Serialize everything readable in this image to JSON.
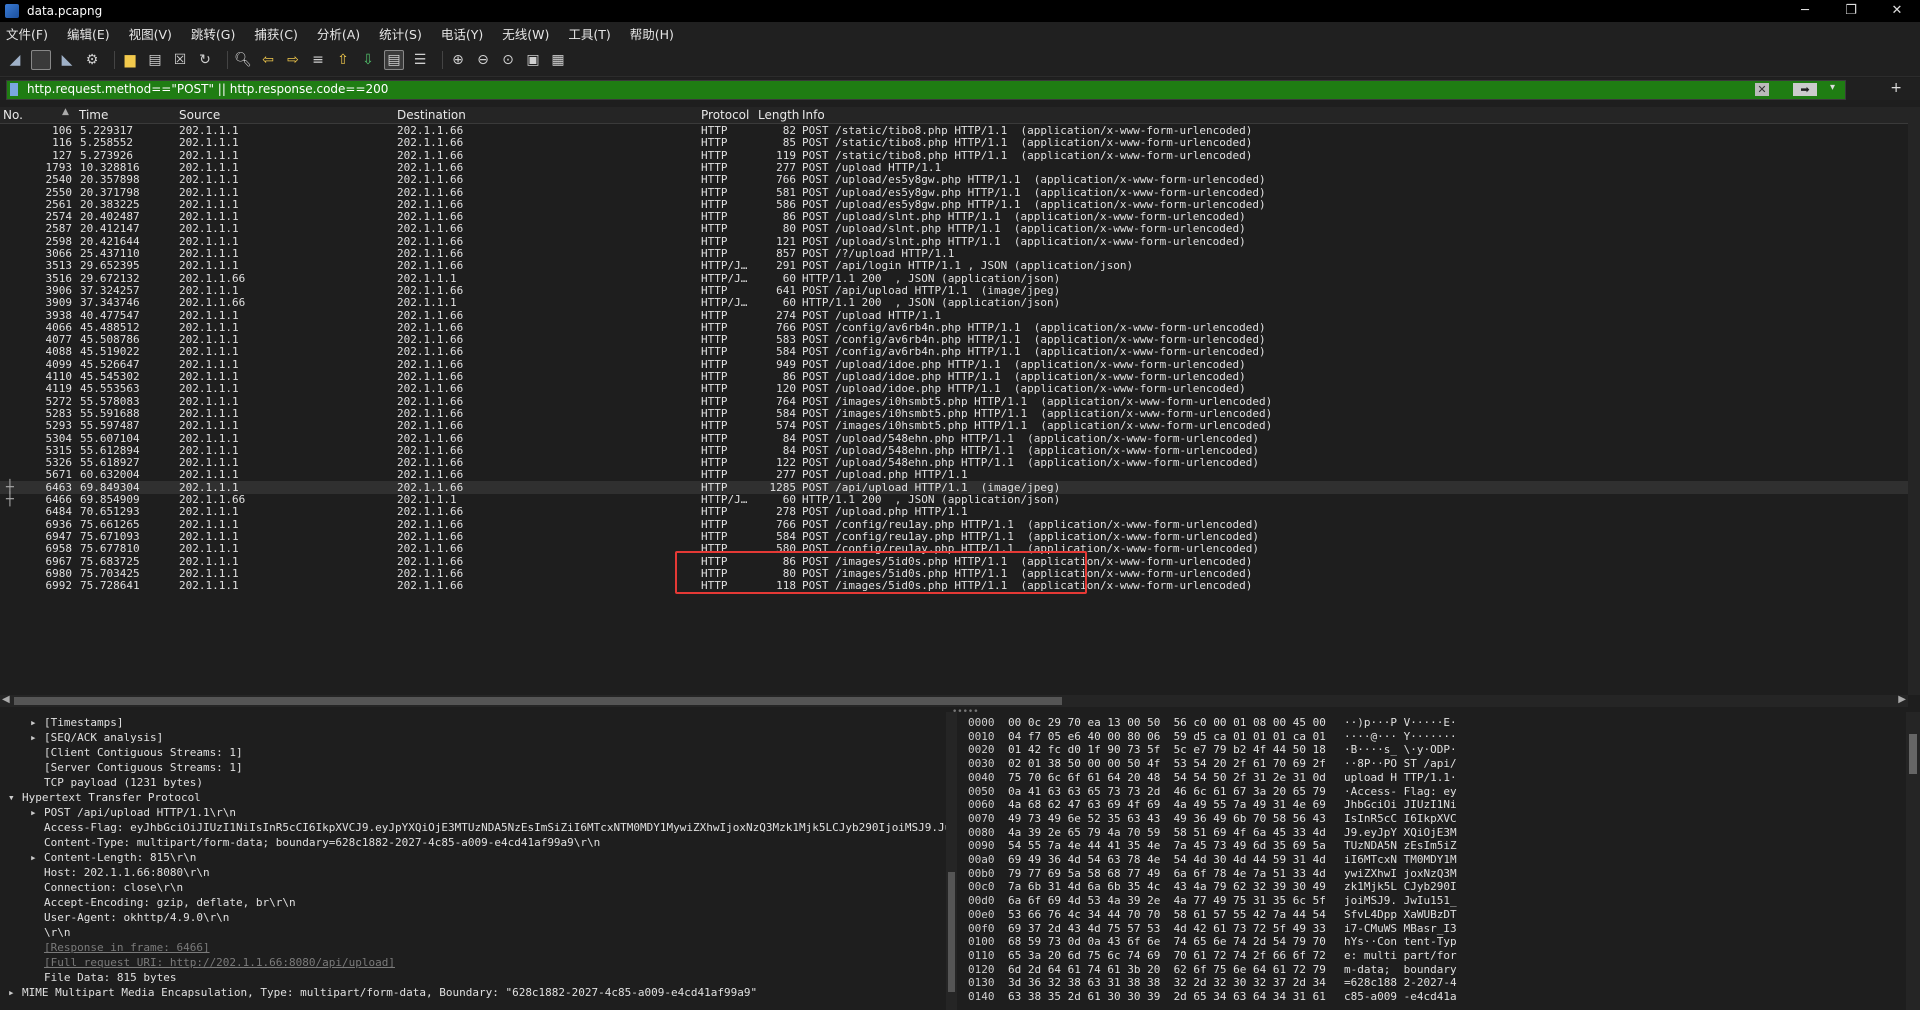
{
  "window": {
    "title": "data.pcapng",
    "controls": [
      "─",
      "❐",
      "✕"
    ]
  },
  "menu": [
    "文件(F)",
    "编辑(E)",
    "视图(V)",
    "跳转(G)",
    "捕获(C)",
    "分析(A)",
    "统计(S)",
    "电话(Y)",
    "无线(W)",
    "工具(T)",
    "帮助(H)"
  ],
  "filter": {
    "text": "http.request.method==\"POST\" || http.response.code==200"
  },
  "columns": {
    "no": "No.",
    "time": "Time",
    "source": "Source",
    "destination": "Destination",
    "protocol": "Protocol",
    "length": "Length",
    "info": "Info"
  },
  "packets": [
    [
      "106",
      "5.229317",
      "202.1.1.1",
      "202.1.1.66",
      "HTTP",
      "82",
      "POST /static/tibo8.php HTTP/1.1  (application/x-www-form-urlencoded)"
    ],
    [
      "116",
      "5.258552",
      "202.1.1.1",
      "202.1.1.66",
      "HTTP",
      "85",
      "POST /static/tibo8.php HTTP/1.1  (application/x-www-form-urlencoded)"
    ],
    [
      "127",
      "5.273926",
      "202.1.1.1",
      "202.1.1.66",
      "HTTP",
      "119",
      "POST /static/tibo8.php HTTP/1.1  (application/x-www-form-urlencoded)"
    ],
    [
      "1793",
      "10.328816",
      "202.1.1.1",
      "202.1.1.66",
      "HTTP",
      "277",
      "POST /upload HTTP/1.1"
    ],
    [
      "2540",
      "20.357898",
      "202.1.1.1",
      "202.1.1.66",
      "HTTP",
      "766",
      "POST /upload/es5y8gw.php HTTP/1.1  (application/x-www-form-urlencoded)"
    ],
    [
      "2550",
      "20.371798",
      "202.1.1.1",
      "202.1.1.66",
      "HTTP",
      "581",
      "POST /upload/es5y8gw.php HTTP/1.1  (application/x-www-form-urlencoded)"
    ],
    [
      "2561",
      "20.383225",
      "202.1.1.1",
      "202.1.1.66",
      "HTTP",
      "586",
      "POST /upload/es5y8gw.php HTTP/1.1  (application/x-www-form-urlencoded)"
    ],
    [
      "2574",
      "20.402487",
      "202.1.1.1",
      "202.1.1.66",
      "HTTP",
      "86",
      "POST /upload/slnt.php HTTP/1.1  (application/x-www-form-urlencoded)"
    ],
    [
      "2587",
      "20.412147",
      "202.1.1.1",
      "202.1.1.66",
      "HTTP",
      "80",
      "POST /upload/slnt.php HTTP/1.1  (application/x-www-form-urlencoded)"
    ],
    [
      "2598",
      "20.421644",
      "202.1.1.1",
      "202.1.1.66",
      "HTTP",
      "121",
      "POST /upload/slnt.php HTTP/1.1  (application/x-www-form-urlencoded)"
    ],
    [
      "3066",
      "25.437110",
      "202.1.1.1",
      "202.1.1.66",
      "HTTP",
      "857",
      "POST /?/upload HTTP/1.1"
    ],
    [
      "3513",
      "29.652395",
      "202.1.1.1",
      "202.1.1.66",
      "HTTP/J…",
      "291",
      "POST /api/login HTTP/1.1 , JSON (application/json)"
    ],
    [
      "3516",
      "29.672132",
      "202.1.1.66",
      "202.1.1.1",
      "HTTP/J…",
      "60",
      "HTTP/1.1 200  , JSON (application/json)"
    ],
    [
      "3906",
      "37.324257",
      "202.1.1.1",
      "202.1.1.66",
      "HTTP",
      "641",
      "POST /api/upload HTTP/1.1  (image/jpeg)"
    ],
    [
      "3909",
      "37.343746",
      "202.1.1.66",
      "202.1.1.1",
      "HTTP/J…",
      "60",
      "HTTP/1.1 200  , JSON (application/json)"
    ],
    [
      "3938",
      "40.477547",
      "202.1.1.1",
      "202.1.1.66",
      "HTTP",
      "274",
      "POST /upload HTTP/1.1"
    ],
    [
      "4066",
      "45.488512",
      "202.1.1.1",
      "202.1.1.66",
      "HTTP",
      "766",
      "POST /config/av6rb4n.php HTTP/1.1  (application/x-www-form-urlencoded)"
    ],
    [
      "4077",
      "45.508786",
      "202.1.1.1",
      "202.1.1.66",
      "HTTP",
      "583",
      "POST /config/av6rb4n.php HTTP/1.1  (application/x-www-form-urlencoded)"
    ],
    [
      "4088",
      "45.519022",
      "202.1.1.1",
      "202.1.1.66",
      "HTTP",
      "584",
      "POST /config/av6rb4n.php HTTP/1.1  (application/x-www-form-urlencoded)"
    ],
    [
      "4099",
      "45.526647",
      "202.1.1.1",
      "202.1.1.66",
      "HTTP",
      "949",
      "POST /upload/idoe.php HTTP/1.1  (application/x-www-form-urlencoded)"
    ],
    [
      "4110",
      "45.545302",
      "202.1.1.1",
      "202.1.1.66",
      "HTTP",
      "86",
      "POST /upload/idoe.php HTTP/1.1  (application/x-www-form-urlencoded)"
    ],
    [
      "4119",
      "45.553563",
      "202.1.1.1",
      "202.1.1.66",
      "HTTP",
      "120",
      "POST /upload/idoe.php HTTP/1.1  (application/x-www-form-urlencoded)"
    ],
    [
      "5272",
      "55.578083",
      "202.1.1.1",
      "202.1.1.66",
      "HTTP",
      "764",
      "POST /images/i0hsmbt5.php HTTP/1.1  (application/x-www-form-urlencoded)"
    ],
    [
      "5283",
      "55.591688",
      "202.1.1.1",
      "202.1.1.66",
      "HTTP",
      "584",
      "POST /images/i0hsmbt5.php HTTP/1.1  (application/x-www-form-urlencoded)"
    ],
    [
      "5293",
      "55.597487",
      "202.1.1.1",
      "202.1.1.66",
      "HTTP",
      "574",
      "POST /images/i0hsmbt5.php HTTP/1.1  (application/x-www-form-urlencoded)"
    ],
    [
      "5304",
      "55.607104",
      "202.1.1.1",
      "202.1.1.66",
      "HTTP",
      "84",
      "POST /upload/548ehn.php HTTP/1.1  (application/x-www-form-urlencoded)"
    ],
    [
      "5315",
      "55.612894",
      "202.1.1.1",
      "202.1.1.66",
      "HTTP",
      "84",
      "POST /upload/548ehn.php HTTP/1.1  (application/x-www-form-urlencoded)"
    ],
    [
      "5326",
      "55.618927",
      "202.1.1.1",
      "202.1.1.66",
      "HTTP",
      "122",
      "POST /upload/548ehn.php HTTP/1.1  (application/x-www-form-urlencoded)"
    ],
    [
      "5671",
      "60.632004",
      "202.1.1.1",
      "202.1.1.66",
      "HTTP",
      "277",
      "POST /upload.php HTTP/1.1"
    ],
    [
      "6463",
      "69.849304",
      "202.1.1.1",
      "202.1.1.66",
      "HTTP",
      "1285",
      "POST /api/upload HTTP/1.1  (image/jpeg)"
    ],
    [
      "6466",
      "69.854909",
      "202.1.1.66",
      "202.1.1.1",
      "HTTP/J…",
      "60",
      "HTTP/1.1 200  , JSON (application/json)"
    ],
    [
      "6484",
      "70.651293",
      "202.1.1.1",
      "202.1.1.66",
      "HTTP",
      "278",
      "POST /upload.php HTTP/1.1"
    ],
    [
      "6936",
      "75.661265",
      "202.1.1.1",
      "202.1.1.66",
      "HTTP",
      "766",
      "POST /config/reu1ay.php HTTP/1.1  (application/x-www-form-urlencoded)"
    ],
    [
      "6947",
      "75.671093",
      "202.1.1.1",
      "202.1.1.66",
      "HTTP",
      "584",
      "POST /config/reu1ay.php HTTP/1.1  (application/x-www-form-urlencoded)"
    ],
    [
      "6958",
      "75.677810",
      "202.1.1.1",
      "202.1.1.66",
      "HTTP",
      "580",
      "POST /config/reu1ay.php HTTP/1.1  (application/x-www-form-urlencoded)"
    ],
    [
      "6967",
      "75.683725",
      "202.1.1.1",
      "202.1.1.66",
      "HTTP",
      "86",
      "POST /images/5id0s.php HTTP/1.1  (application/x-www-form-urlencoded)"
    ],
    [
      "6980",
      "75.703425",
      "202.1.1.1",
      "202.1.1.66",
      "HTTP",
      "80",
      "POST /images/5id0s.php HTTP/1.1  (application/x-www-form-urlencoded)"
    ],
    [
      "6992",
      "75.728641",
      "202.1.1.1",
      "202.1.1.66",
      "HTTP",
      "118",
      "POST /images/5id0s.php HTTP/1.1  (application/x-www-form-urlencoded)"
    ]
  ],
  "details": [
    {
      "indent": 3,
      "arrow": "▸",
      "text": "[Timestamps]"
    },
    {
      "indent": 3,
      "arrow": "▸",
      "text": "[SEQ/ACK analysis]"
    },
    {
      "indent": 3,
      "arrow": "",
      "text": "[Client Contiguous Streams: 1]"
    },
    {
      "indent": 3,
      "arrow": "",
      "text": "[Server Contiguous Streams: 1]"
    },
    {
      "indent": 3,
      "arrow": "",
      "text": "TCP payload (1231 bytes)"
    },
    {
      "indent": 1,
      "arrow": "▾",
      "text": "Hypertext Transfer Protocol"
    },
    {
      "indent": 3,
      "arrow": "▸",
      "text": "POST /api/upload HTTP/1.1\\r\\n"
    },
    {
      "indent": 3,
      "arrow": "",
      "text": "Access-Flag: eyJhbGciOiJIUzI1NiIsInR5cCI6IkpXVCJ9.eyJpYXQiOjE3MTUzNDA5NzEsImSiZiI6MTcxNTM0MDY1MywiZXhwIjoxNzQ3Mzk1Mjk5LCJyb290IjoiMSJ9.Ju"
    },
    {
      "indent": 3,
      "arrow": "",
      "text": "Content-Type: multipart/form-data; boundary=628c1882-2027-4c85-a009-e4cd41af99a9\\r\\n"
    },
    {
      "indent": 3,
      "arrow": "▸",
      "text": "Content-Length: 815\\r\\n"
    },
    {
      "indent": 3,
      "arrow": "",
      "text": "Host: 202.1.1.66:8080\\r\\n"
    },
    {
      "indent": 3,
      "arrow": "",
      "text": "Connection: close\\r\\n"
    },
    {
      "indent": 3,
      "arrow": "",
      "text": "Accept-Encoding: gzip, deflate, br\\r\\n"
    },
    {
      "indent": 3,
      "arrow": "",
      "text": "User-Agent: okhttp/4.9.0\\r\\n"
    },
    {
      "indent": 3,
      "arrow": "",
      "text": "\\r\\n"
    },
    {
      "indent": 3,
      "arrow": "",
      "text": "[Response in frame: 6466]",
      "link": true
    },
    {
      "indent": 3,
      "arrow": "",
      "text": "[Full request URI: http://202.1.1.66:8080/api/upload]",
      "link": true
    },
    {
      "indent": 3,
      "arrow": "",
      "text": "File Data: 815 bytes"
    },
    {
      "indent": 1,
      "arrow": "▸",
      "text": "MIME Multipart Media Encapsulation, Type: multipart/form-data, Boundary: \"628c1882-2027-4c85-a009-e4cd41af99a9\""
    }
  ],
  "bytes": [
    [
      "0000",
      "00 0c 29 70 ea 13 00 50  56 c0 00 01 08 00 45 00",
      "··)p···P V·····E·"
    ],
    [
      "0010",
      "04 f7 05 e6 40 00 80 06  59 d5 ca 01 01 01 ca 01",
      "····@··· Y·······"
    ],
    [
      "0020",
      "01 42 fc d0 1f 90 73 5f  5c e7 79 b2 4f 44 50 18",
      "·B····s_ \\·y·ODP·"
    ],
    [
      "0030",
      "02 01 38 50 00 00 50 4f  53 54 20 2f 61 70 69 2f",
      "··8P··PO ST /api/"
    ],
    [
      "0040",
      "75 70 6c 6f 61 64 20 48  54 54 50 2f 31 2e 31 0d",
      "upload H TTP/1.1·"
    ],
    [
      "0050",
      "0a 41 63 63 65 73 73 2d  46 6c 61 67 3a 20 65 79",
      "·Access- Flag: ey"
    ],
    [
      "0060",
      "4a 68 62 47 63 69 4f 69  4a 49 55 7a 49 31 4e 69",
      "JhbGciOi JIUzI1Ni"
    ],
    [
      "0070",
      "49 73 49 6e 52 35 63 43  49 36 49 6b 70 58 56 43",
      "IsInR5cC I6IkpXVC"
    ],
    [
      "0080",
      "4a 39 2e 65 79 4a 70 59  58 51 69 4f 6a 45 33 4d",
      "J9.eyJpY XQiOjE3M"
    ],
    [
      "0090",
      "54 55 7a 4e 44 41 35 4e  7a 45 73 49 6d 35 69 5a",
      "TUzNDA5N zEsIm5iZ"
    ],
    [
      "00a0",
      "69 49 36 4d 54 63 78 4e  54 4d 30 4d 44 59 31 4d",
      "iI6MTcxN TM0MDY1M"
    ],
    [
      "00b0",
      "79 77 69 5a 58 68 77 49  6a 6f 78 4e 7a 51 33 4d",
      "ywiZXhwI joxNzQ3M"
    ],
    [
      "00c0",
      "7a 6b 31 4d 6a 6b 35 4c  43 4a 79 62 32 39 30 49",
      "zk1Mjk5L CJyb290I"
    ],
    [
      "00d0",
      "6a 6f 69 4d 53 4a 39 2e  4a 77 49 75 31 35 6c 5f",
      "joiMSJ9. JwIu151_"
    ],
    [
      "00e0",
      "53 66 76 4c 34 44 70 70  58 61 57 55 42 7a 44 54",
      "SfvL4Dpp XaWUBzDT"
    ],
    [
      "00f0",
      "69 37 2d 43 4d 75 57 53  4d 42 61 73 72 5f 49 33",
      "i7-CMuWS MBasr_I3"
    ],
    [
      "0100",
      "68 59 73 0d 0a 43 6f 6e  74 65 6e 74 2d 54 79 70",
      "hYs··Con tent-Typ"
    ],
    [
      "0110",
      "65 3a 20 6d 75 6c 74 69  70 61 72 74 2f 66 6f 72",
      "e: multi part/for"
    ],
    [
      "0120",
      "6d 2d 64 61 74 61 3b 20  62 6f 75 6e 64 61 72 79",
      "m-data;  boundary"
    ],
    [
      "0130",
      "3d 36 32 38 63 31 38 38  32 2d 32 30 32 37 2d 34",
      "=628c188 2-2027-4"
    ],
    [
      "0140",
      "63 38 35 2d 61 30 30 39  2d 65 34 63 64 34 31 61",
      "c85-a009 -e4cd41a"
    ]
  ]
}
